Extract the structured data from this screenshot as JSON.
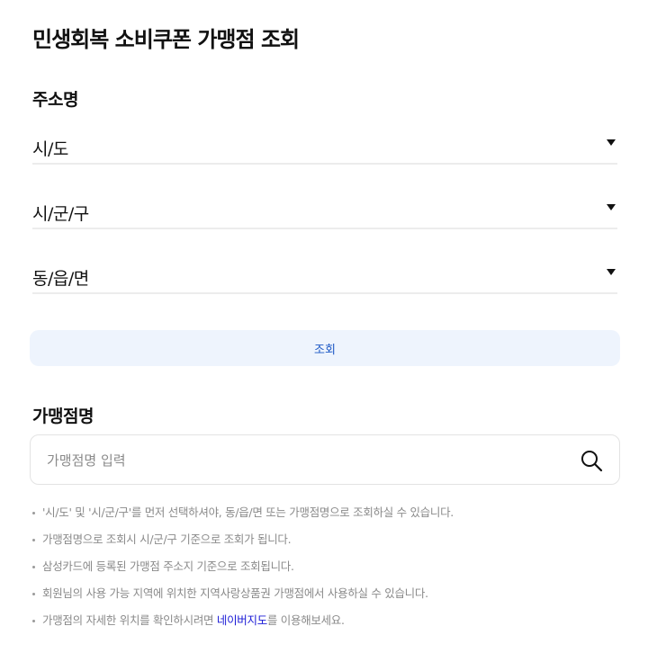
{
  "page": {
    "title": "민생회복 소비쿠폰 가맹점 조회"
  },
  "address_section": {
    "title": "주소명",
    "selects": [
      {
        "label": "시/도"
      },
      {
        "label": "시/군/구"
      },
      {
        "label": "동/읍/면"
      }
    ],
    "search_button_label": "조회"
  },
  "store_section": {
    "title": "가맹점명",
    "search_placeholder": "가맹점명 입력",
    "search_value": ""
  },
  "notes": [
    {
      "text": "'시/도' 및 '시/군/구'를 먼저 선택하셔야, 동/읍/면 또는 가맹점명으로 조회하실 수 있습니다."
    },
    {
      "text": "가맹점명으로 조회시 시/군/구 기준으로 조회가 됩니다."
    },
    {
      "text": "삼성카드에 등록된 가맹점 주소지 기준으로 조회됩니다."
    },
    {
      "text": "회원님의 사용 가능 지역에 위치한 지역사랑상품권 가맹점에서 사용하실 수 있습니다."
    },
    {
      "text_before": "가맹점의 자세한 위치를 확인하시려면 ",
      "link": "네이버지도",
      "text_after": "를 이용해보세요."
    }
  ],
  "colors": {
    "accent": "#1a56c4",
    "button_bg": "#eef4fd",
    "link": "#1a1ad6",
    "muted_text": "#8a8a8a"
  },
  "icons": {
    "select_caret": "caret-down-icon",
    "search": "search-icon"
  }
}
